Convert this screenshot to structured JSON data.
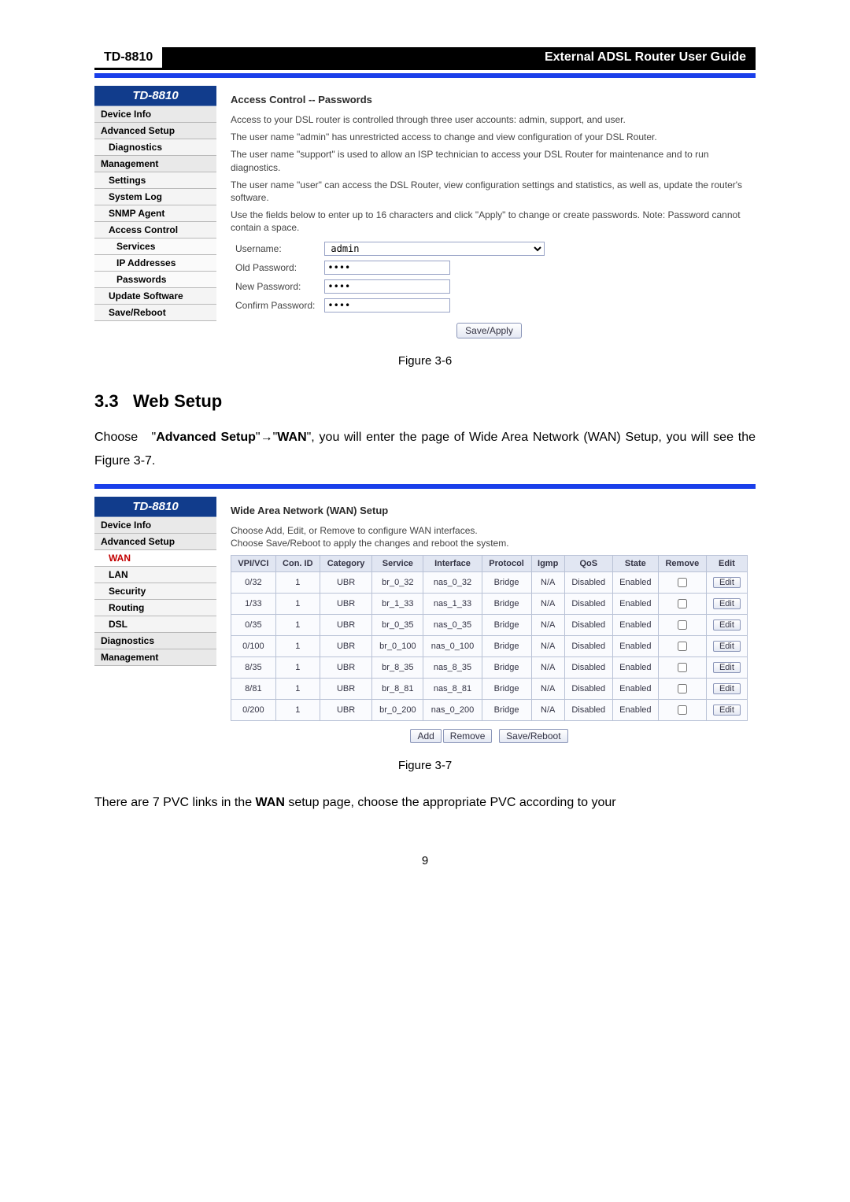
{
  "header": {
    "model": "TD-8810",
    "title": "External ADSL Router User Guide"
  },
  "fig1": {
    "logo": "TD-8810",
    "sidebar": [
      "Device Info",
      "Advanced Setup",
      "Diagnostics",
      "Management"
    ],
    "sidebar_sub": [
      "Settings",
      "System Log",
      "SNMP Agent",
      "Access Control"
    ],
    "sidebar_sub2": [
      "Services",
      "IP Addresses",
      "Passwords"
    ],
    "sidebar_tail": [
      "Update Software",
      "Save/Reboot"
    ],
    "title": "Access Control -- Passwords",
    "p1": "Access to your DSL router is controlled through three user accounts: admin, support, and user.",
    "p2": "The user name \"admin\" has unrestricted access to change and view configuration of your DSL Router.",
    "p3": "The user name \"support\" is used to allow an ISP technician to access your DSL Router for maintenance and to run diagnostics.",
    "p4": "The user name \"user\" can access the DSL Router, view configuration settings and statistics, as well as, update the router's software.",
    "p5": "Use the fields below to enter up to 16 characters and click \"Apply\" to change or create passwords. Note: Password cannot contain a space.",
    "labels": {
      "user": "Username:",
      "old": "Old Password:",
      "new": "New Password:",
      "conf": "Confirm Password:"
    },
    "username": "admin",
    "pwd": "••••",
    "save": "Save/Apply",
    "caption": "Figure 3-6"
  },
  "section": {
    "num": "3.3",
    "title": "Web Setup"
  },
  "para1_a": "Choose   \"",
  "para1_b": "Advanced Setup",
  "para1_c": "\"",
  "para1_d": "→",
  "para1_e": "\"",
  "para1_f": "WAN",
  "para1_g": "\", you will enter the page of Wide Area Network (WAN) Setup, you will see the Figure 3-7.",
  "fig2": {
    "logo": "TD-8810",
    "sidebar": [
      "Device Info",
      "Advanced Setup"
    ],
    "sidebar_sub": [
      "WAN",
      "LAN",
      "Security",
      "Routing",
      "DSL"
    ],
    "sidebar_tail": [
      "Diagnostics",
      "Management"
    ],
    "title": "Wide Area Network (WAN) Setup",
    "p1": "Choose Add, Edit, or Remove to configure WAN interfaces.",
    "p2": "Choose Save/Reboot to apply the changes and reboot the system.",
    "headers": [
      "VPI/VCI",
      "Con. ID",
      "Category",
      "Service",
      "Interface",
      "Protocol",
      "Igmp",
      "QoS",
      "State",
      "Remove",
      "Edit"
    ],
    "rows": [
      {
        "vpi": "0/32",
        "con": "1",
        "cat": "UBR",
        "svc": "br_0_32",
        "iface": "nas_0_32",
        "proto": "Bridge",
        "igmp": "N/A",
        "qos": "Disabled",
        "state": "Enabled"
      },
      {
        "vpi": "1/33",
        "con": "1",
        "cat": "UBR",
        "svc": "br_1_33",
        "iface": "nas_1_33",
        "proto": "Bridge",
        "igmp": "N/A",
        "qos": "Disabled",
        "state": "Enabled"
      },
      {
        "vpi": "0/35",
        "con": "1",
        "cat": "UBR",
        "svc": "br_0_35",
        "iface": "nas_0_35",
        "proto": "Bridge",
        "igmp": "N/A",
        "qos": "Disabled",
        "state": "Enabled"
      },
      {
        "vpi": "0/100",
        "con": "1",
        "cat": "UBR",
        "svc": "br_0_100",
        "iface": "nas_0_100",
        "proto": "Bridge",
        "igmp": "N/A",
        "qos": "Disabled",
        "state": "Enabled"
      },
      {
        "vpi": "8/35",
        "con": "1",
        "cat": "UBR",
        "svc": "br_8_35",
        "iface": "nas_8_35",
        "proto": "Bridge",
        "igmp": "N/A",
        "qos": "Disabled",
        "state": "Enabled"
      },
      {
        "vpi": "8/81",
        "con": "1",
        "cat": "UBR",
        "svc": "br_8_81",
        "iface": "nas_8_81",
        "proto": "Bridge",
        "igmp": "N/A",
        "qos": "Disabled",
        "state": "Enabled"
      },
      {
        "vpi": "0/200",
        "con": "1",
        "cat": "UBR",
        "svc": "br_0_200",
        "iface": "nas_0_200",
        "proto": "Bridge",
        "igmp": "N/A",
        "qos": "Disabled",
        "state": "Enabled"
      }
    ],
    "edit": "Edit",
    "buttons": [
      "Add",
      "Remove",
      "Save/Reboot"
    ],
    "caption": "Figure 3-7"
  },
  "para2_a": "There are 7 PVC links in the ",
  "para2_b": "WAN",
  "para2_c": " setup page, choose the appropriate PVC according to your",
  "pagenum": "9"
}
